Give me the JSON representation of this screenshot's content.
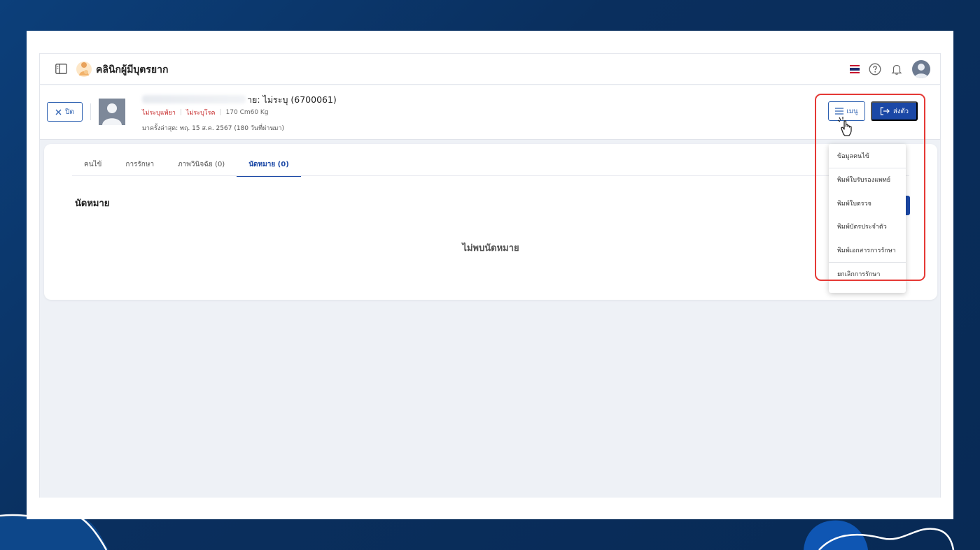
{
  "app": {
    "title": "คลินิกผู้มีบุตรยาก"
  },
  "patient": {
    "name_visible": "าย: ไม่ระบุ  (6700061)",
    "allergy": "ไม่ระบุแพ้ยา",
    "disease": "ไม่ระบุโรค",
    "body": "170 Cm60 Kg",
    "last_visit": "มาครั้งล่าสุด: พฤ. 15 ส.ค. 2567 (180 วันที่ผ่านมา)"
  },
  "actions": {
    "close_label": "ปิด",
    "menu_label": "เมนู",
    "send_label": "ส่งตัว"
  },
  "tabs": [
    {
      "label": "คนไข้"
    },
    {
      "label": "การรักษา"
    },
    {
      "label": "ภาพวินิจฉัย (0)"
    },
    {
      "label": "นัดหมาย (0)"
    }
  ],
  "section": {
    "title": "นัดหมาย",
    "empty": "ไม่พบนัดหมาย"
  },
  "menu_items": [
    {
      "label": "ข้อมูลคนไข้"
    },
    {
      "label": "พิมพ์ใบรับรองแพทย์"
    },
    {
      "label": "พิมพ์ใบตรวจ"
    },
    {
      "label": "พิมพ์บัตรประจำตัว"
    },
    {
      "label": "พิมพ์เอกสารการรักษา"
    },
    {
      "label": "ยกเลิกการรักษา"
    }
  ],
  "colors": {
    "primary": "#1b48a6",
    "alert_red": "#c62828",
    "highlight_red": "#e53935",
    "background": "#0a2f5e"
  }
}
